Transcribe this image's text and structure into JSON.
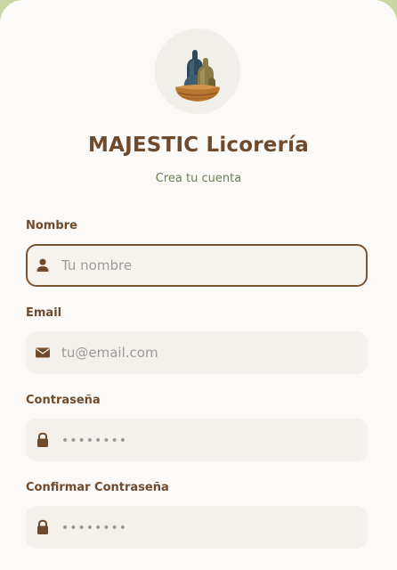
{
  "brand": {
    "name": "MAJESTIC Licorería",
    "subtitle": "Crea tu cuenta"
  },
  "colors": {
    "accent": "#6f4a2c",
    "subtitle": "#6a7d54",
    "field_bg": "#f4f1ed"
  },
  "form": {
    "fields": [
      {
        "label": "Nombre",
        "placeholder": "Tu nombre",
        "icon": "user-icon",
        "type": "text",
        "focused": true
      },
      {
        "label": "Email",
        "placeholder": "tu@email.com",
        "icon": "envelope-icon",
        "type": "email",
        "focused": false
      },
      {
        "label": "Contraseña",
        "placeholder": "••••••••",
        "icon": "lock-icon",
        "type": "password",
        "focused": false
      },
      {
        "label": "Confirmar Contraseña",
        "placeholder": "••••••••",
        "icon": "lock-icon",
        "type": "password",
        "focused": false
      }
    ]
  }
}
